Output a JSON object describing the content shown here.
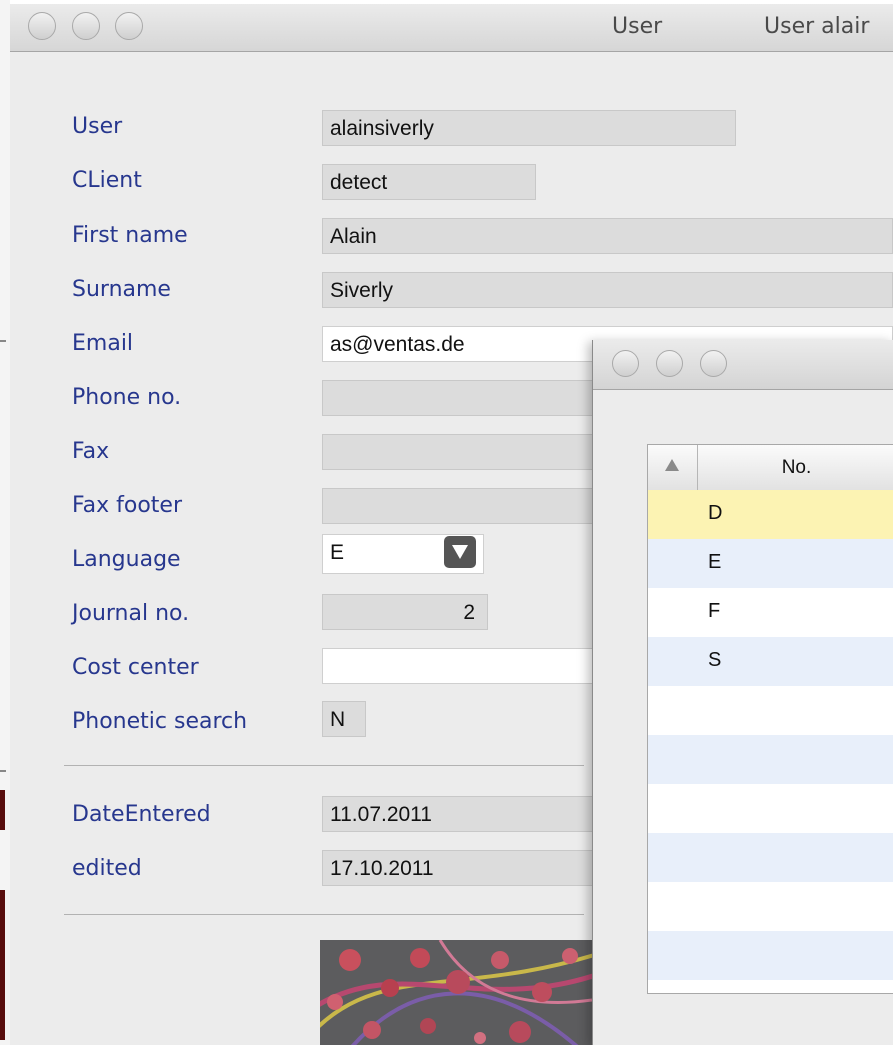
{
  "window": {
    "title_left": "User",
    "title_right": "User alair"
  },
  "form": {
    "fields": [
      {
        "label": "User",
        "value": "alainsiverly"
      },
      {
        "label": "CLient",
        "value": "detect"
      },
      {
        "label": "First name",
        "value": "Alain"
      },
      {
        "label": "Surname",
        "value": "Siverly"
      },
      {
        "label": "Email",
        "value": "as@ventas.de"
      },
      {
        "label": "Phone no.",
        "value": ""
      },
      {
        "label": "Fax",
        "value": ""
      },
      {
        "label": "Fax footer",
        "value": ""
      },
      {
        "label": "Language",
        "value": "E"
      },
      {
        "label": "Journal no.",
        "value": "2"
      },
      {
        "label": "Cost center",
        "value": ""
      },
      {
        "label": "Phonetic search",
        "value": "N"
      }
    ],
    "dates": [
      {
        "label": "DateEntered",
        "value": "11.07.2011"
      },
      {
        "label": "edited",
        "value": "17.10.2011"
      }
    ]
  },
  "popup": {
    "column_header": "No.",
    "rows": [
      "D",
      "E",
      "F",
      "S",
      "",
      "",
      "",
      "",
      "",
      ""
    ],
    "selected_row_color": "#fcf3b3",
    "stripe_color": "#e8effa"
  },
  "icons": [
    "dropdown-arrow-icon",
    "sort-ascending-icon"
  ]
}
